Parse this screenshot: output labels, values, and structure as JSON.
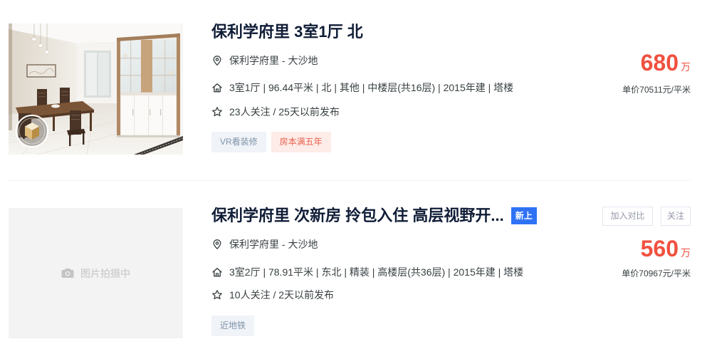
{
  "listings": [
    {
      "title": "保利学府里 3室1厅 北",
      "location": "保利学府里 - 大沙地",
      "house_info": "3室1厅 | 96.44平米 | 北 | 其他 | 中楼层(共16层) | 2015年建 | 塔楼",
      "follow_info": "23人关注 / 25天以前发布",
      "tags": [
        {
          "label": "VR看装修",
          "color": "#7f93a8",
          "bg": "#f0f3f8"
        },
        {
          "label": "房本满五年",
          "color": "#e9604d",
          "bg": "#fdece8"
        }
      ],
      "price": "680",
      "price_unit": "万",
      "unit_price": "单价70511元/平米",
      "image_icon": "vr-icon"
    },
    {
      "title": "保利学府里 次新房 拎包入住 高层视野开...",
      "badge": "新上",
      "location": "保利学府里 - 大沙地",
      "house_info": "3室2厅 | 78.91平米 | 东北 | 精装 | 高楼层(共36层) | 2015年建 | 塔楼",
      "follow_info": "10人关注 / 2天以前发布",
      "tags": [
        {
          "label": "近地铁",
          "color": "#7f93a8",
          "bg": "#f0f3f8"
        }
      ],
      "price": "560",
      "price_unit": "万",
      "unit_price": "单价70967元/平米",
      "image_placeholder": "图片拍摄中",
      "image_icon": "camera-icon",
      "actions": {
        "compare": "加入对比",
        "follow": "关注"
      }
    }
  ],
  "icons": {
    "location": "location-pin-icon",
    "house_info": "house-icon",
    "follow_info": "star-icon"
  },
  "colors": {
    "title": "#101d37",
    "text": "#394043",
    "price": "#f0503f",
    "new_badge": "#3072f6",
    "action_border": "#e4e6f0",
    "action_text": "#9399a5",
    "divider": "#f0f1f3",
    "placeholder_bg": "#f3f3f3"
  }
}
